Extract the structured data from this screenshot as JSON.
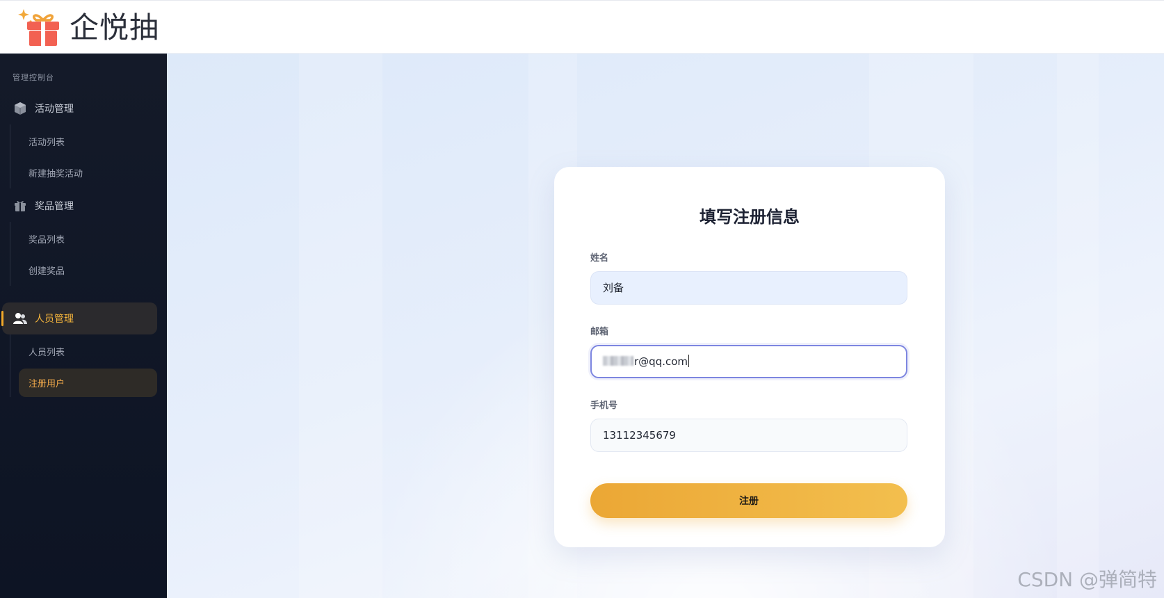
{
  "header": {
    "app_name": "企悦抽"
  },
  "sidebar": {
    "caption": "管理控制台",
    "groups": [
      {
        "label": "活动管理",
        "icon": "cube-icon",
        "items": [
          {
            "label": "活动列表"
          },
          {
            "label": "新建抽奖活动"
          }
        ]
      },
      {
        "label": "奖品管理",
        "icon": "gift-icon",
        "items": [
          {
            "label": "奖品列表"
          },
          {
            "label": "创建奖品"
          }
        ]
      },
      {
        "label": "人员管理",
        "icon": "users-icon",
        "active": true,
        "items": [
          {
            "label": "人员列表"
          },
          {
            "label": "注册用户",
            "active": true
          }
        ]
      }
    ]
  },
  "form": {
    "title": "填写注册信息",
    "name_label": "姓名",
    "name_value": "刘备",
    "email_label": "邮箱",
    "email_value_visible": "r@qq.com",
    "phone_label": "手机号",
    "phone_value": "13112345679",
    "submit_label": "注册"
  },
  "watermark": "CSDN @弹简特",
  "colors": {
    "accent": "#f1a829",
    "sidebar_bg": "#0d1424",
    "focus_border": "#7d86e0"
  }
}
